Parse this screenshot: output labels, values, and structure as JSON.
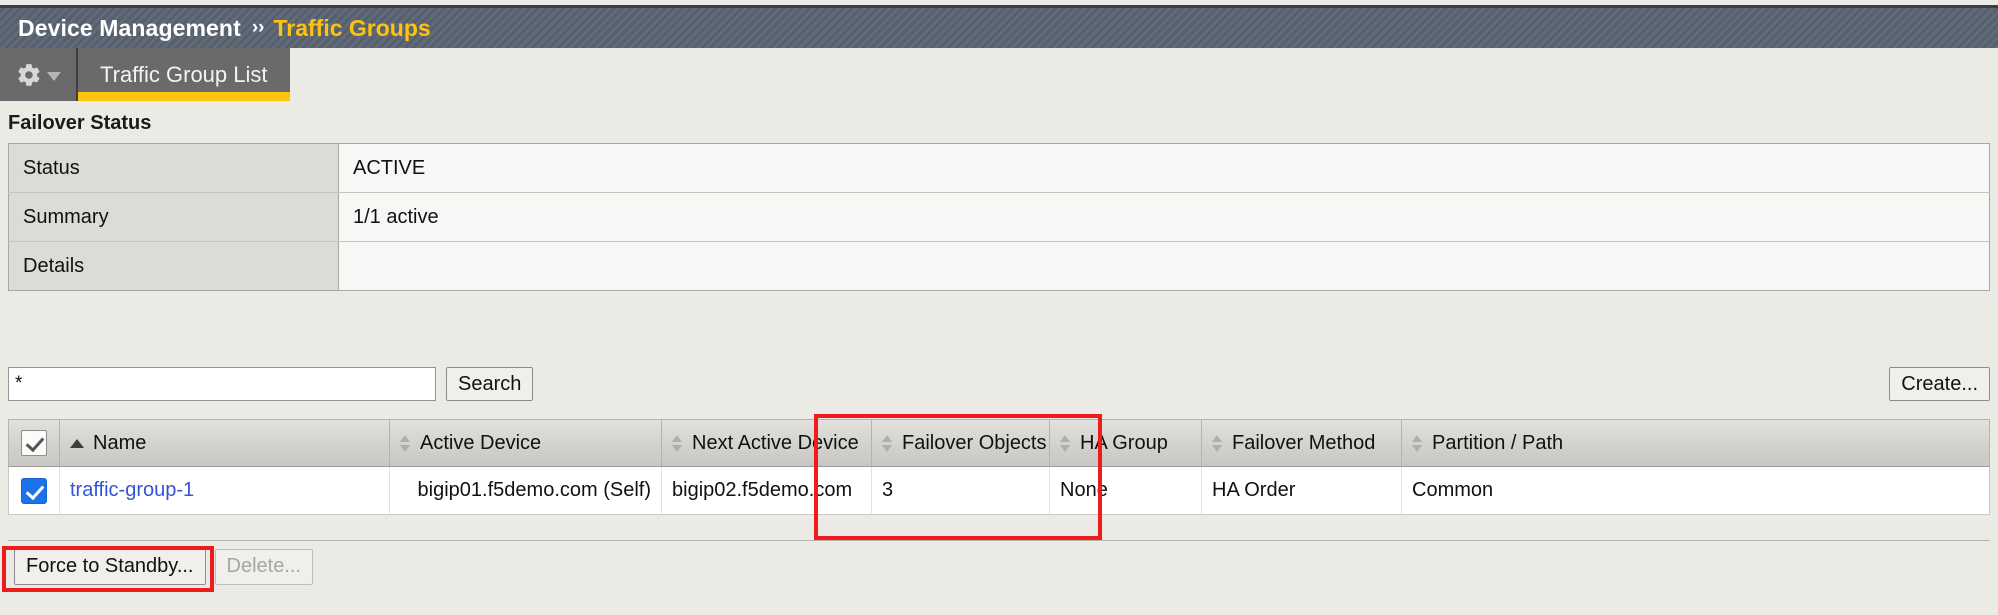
{
  "breadcrumb": {
    "root": "Device Management",
    "separator": "››",
    "current": "Traffic Groups"
  },
  "tabs": {
    "gear_icon": "gear-icon",
    "caret_icon": "chevron-down-icon",
    "items": [
      {
        "label": "Traffic Group List",
        "active": true
      }
    ]
  },
  "failover": {
    "title": "Failover Status",
    "rows": [
      {
        "label": "Status",
        "value": "ACTIVE"
      },
      {
        "label": "Summary",
        "value": "1/1 active"
      },
      {
        "label": "Details",
        "value": ""
      }
    ]
  },
  "search": {
    "value": "*",
    "placeholder": "",
    "search_label": "Search",
    "create_label": "Create..."
  },
  "grid": {
    "select_all_checked": true,
    "columns": [
      {
        "label": "Name",
        "sort": "asc"
      },
      {
        "label": "Active Device",
        "sort": "both"
      },
      {
        "label": "Next Active Device",
        "sort": "both"
      },
      {
        "label": "Failover Objects",
        "sort": "both"
      },
      {
        "label": "HA Group",
        "sort": "both"
      },
      {
        "label": "Failover Method",
        "sort": "both"
      },
      {
        "label": "Partition / Path",
        "sort": "both"
      }
    ],
    "rows": [
      {
        "checked": true,
        "name": "traffic-group-1",
        "active_device": "bigip01.f5demo.com (Self)",
        "next_active_device": "bigip02.f5demo.com",
        "failover_objects": "3",
        "ha_group": "None",
        "failover_method": "HA Order",
        "partition_path": "Common"
      }
    ]
  },
  "footer": {
    "force_standby_label": "Force to Standby...",
    "delete_label": "Delete...",
    "delete_disabled": true
  },
  "annotations": {
    "accent_color": "#ee1c1c",
    "boxes": [
      {
        "name": "next-active-device-highlight"
      },
      {
        "name": "force-to-standby-highlight"
      }
    ]
  }
}
